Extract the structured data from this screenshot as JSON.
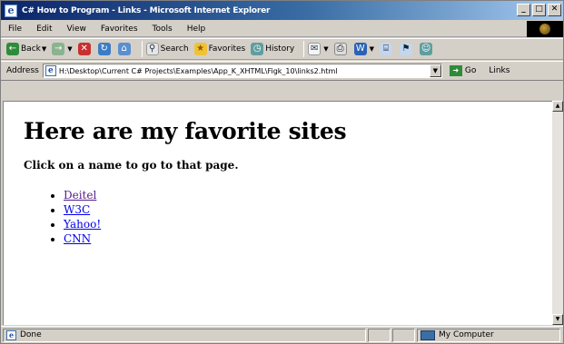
{
  "window": {
    "title": "C# How to Program - Links - Microsoft Internet Explorer",
    "controls": [
      "_",
      "□",
      "✕"
    ]
  },
  "menu": [
    "File",
    "Edit",
    "View",
    "Favorites",
    "Tools",
    "Help"
  ],
  "toolbar": {
    "back_label": "Back",
    "search_label": "Search",
    "favorites_label": "Favorites",
    "history_label": "History"
  },
  "address": {
    "label": "Address",
    "url": "H:\\Desktop\\Current C# Projects\\Examples\\App_K_XHTML\\Figk_10\\links2.html",
    "go_label": "Go",
    "links_label": "Links"
  },
  "page": {
    "heading": "Here are my favorite sites",
    "intro": "Click on a name to go to that page.",
    "links": [
      "Deitel",
      "W3C",
      "Yahoo!",
      "CNN"
    ]
  },
  "status": {
    "text": "Done",
    "zone": "My Computer"
  }
}
